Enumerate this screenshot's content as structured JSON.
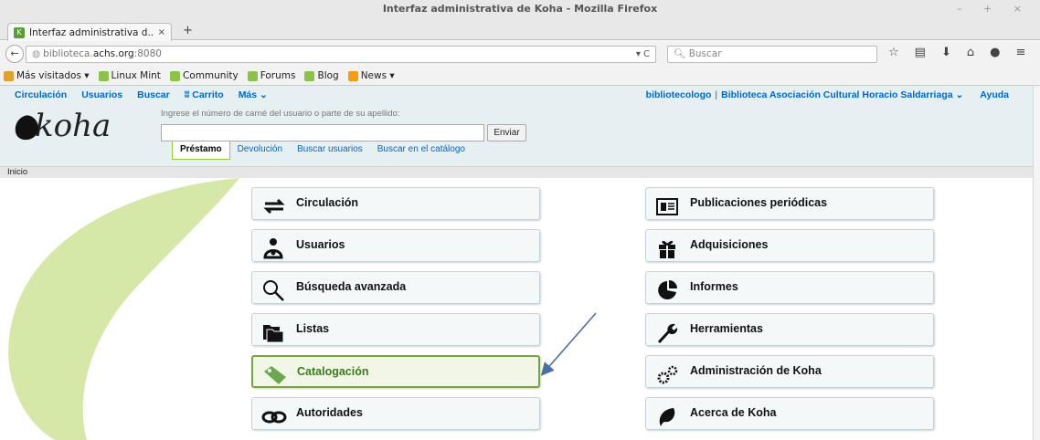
{
  "window": {
    "title": "Interfaz administrativa de Koha - Mozilla Firefox",
    "controls": "– + ×"
  },
  "tab": {
    "title": "Interfaz administrativa d...",
    "close": "×",
    "new_tab": "+"
  },
  "navbar": {
    "back": "←",
    "url_prefix": "biblioteca.",
    "url_host": "achs.org",
    "url_suffix": ":8080",
    "url_dropdown": "▾ C",
    "search_placeholder": "Buscar"
  },
  "bookmarks": [
    {
      "label": "Más visitados ▾",
      "icon": "folder-icon"
    },
    {
      "label": "Linux Mint",
      "icon": "mint-icon"
    },
    {
      "label": "Community",
      "icon": "mint-icon"
    },
    {
      "label": "Forums",
      "icon": "mint-icon"
    },
    {
      "label": "Blog",
      "icon": "mint-icon"
    },
    {
      "label": "News ▾",
      "icon": "rss-icon"
    }
  ],
  "koha": {
    "topnav": {
      "left": [
        "Circulación",
        "Usuarios",
        "Buscar",
        "ʬ Carrito",
        "Más ⌄"
      ],
      "user": "bibliotecologo",
      "separator": "|",
      "library": "Biblioteca Asociación Cultural Horacio Saldarriaga ⌄",
      "help": "Ayuda"
    },
    "logo_text": "koha",
    "patron_prompt": "Ingrese el número de carné del usuario o parte de su apellido:",
    "submit": "Enviar",
    "subtabs": [
      "Préstamo",
      "Devolución",
      "Buscar usuarios",
      "Buscar en el catálogo"
    ],
    "breadcrumb": "Inicio",
    "modules_left": [
      {
        "label": "Circulación",
        "icon": "circulation-arrows-icon"
      },
      {
        "label": "Usuarios",
        "icon": "patrons-icon"
      },
      {
        "label": "Búsqueda avanzada",
        "icon": "magnifier-icon"
      },
      {
        "label": "Listas",
        "icon": "folders-icon"
      },
      {
        "label": "Catalogación",
        "icon": "tag-icon",
        "highlighted": true
      },
      {
        "label": "Autoridades",
        "icon": "chain-link-icon"
      }
    ],
    "modules_right": [
      {
        "label": "Publicaciones periódicas",
        "icon": "newspaper-icon"
      },
      {
        "label": "Adquisiciones",
        "icon": "gift-icon"
      },
      {
        "label": "Informes",
        "icon": "pie-chart-icon"
      },
      {
        "label": "Herramientas",
        "icon": "wrench-icon"
      },
      {
        "label": "Administración de Koha",
        "icon": "gears-icon"
      },
      {
        "label": "Acerca de Koha",
        "icon": "koha-leaf-icon"
      }
    ]
  },
  "colors": {
    "link": "#0066cc",
    "header_bg": "#e6f0f2",
    "swoosh": "#d5e8a8",
    "highlight_border": "#77a640",
    "annotation_arrow": "#4a6fa5"
  }
}
